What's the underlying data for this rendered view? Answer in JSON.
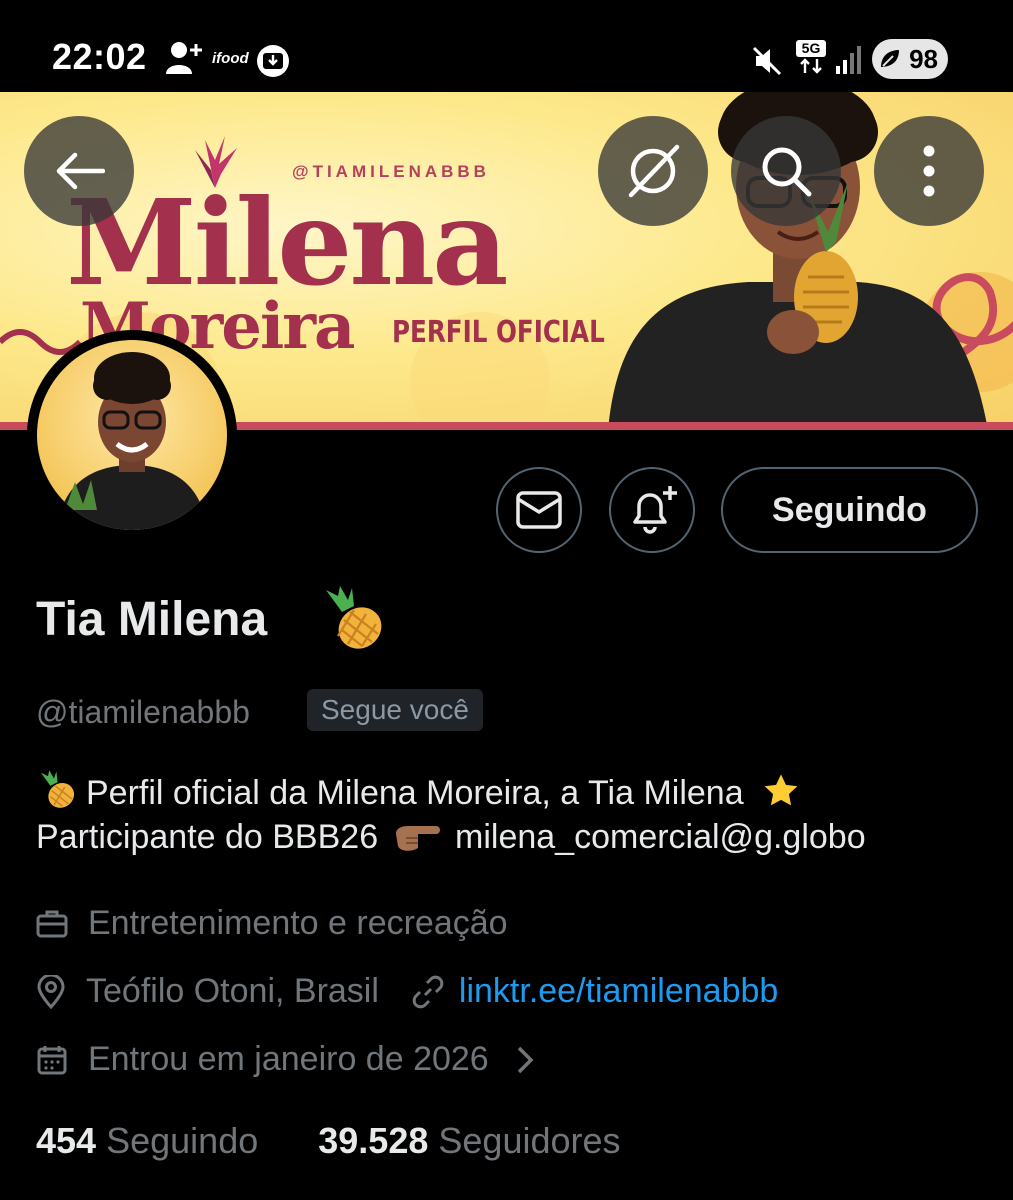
{
  "status_bar": {
    "time": "22:02",
    "notification_icons": [
      "add-person-icon",
      "ifood-icon",
      "download-icon"
    ],
    "ifood_text": "ifood",
    "system_icons": [
      "mute-icon",
      "network-5g-icon",
      "signal-icon",
      "battery-icon"
    ],
    "network_label": "5G",
    "battery": "98"
  },
  "banner": {
    "handle": "@TIAMILENABBB",
    "name": "Milena",
    "surname": "Moreira",
    "tagline": "PERFIL OFICIAL"
  },
  "top_actions": {
    "back_icon": "arrow-left-icon",
    "grok_icon": "grok-icon",
    "search_icon": "search-icon",
    "more_icon": "more-vertical-icon"
  },
  "actions": {
    "message_icon": "envelope-icon",
    "notify_icon": "bell-plus-icon",
    "follow_label": "Seguindo"
  },
  "profile": {
    "display_name": "Tia Milena",
    "handle": "@tiamilenabbb",
    "follows_you": "Segue você",
    "bio_line1": "Perfil oficial da Milena Moreira, a Tia Milena",
    "bio_line2_a": "Participante do BBB26",
    "bio_line2_b": "milena_comercial@g.globo",
    "category": "Entretenimento e recreação",
    "location": "Teófilo Otoni, Brasil",
    "link": "linktr.ee/tiamilenabbb",
    "joined": "Entrou em janeiro de 2026"
  },
  "stats": {
    "following_count": "454",
    "following_label": "Seguindo",
    "followers_count": "39.528",
    "followers_label": "Seguidores"
  },
  "colors": {
    "background": "#000000",
    "text": "#e7e9ea",
    "muted": "#71767b",
    "link": "#1d9bf0",
    "banner_accent": "#a3304d",
    "banner_bg": "#fde98c"
  }
}
